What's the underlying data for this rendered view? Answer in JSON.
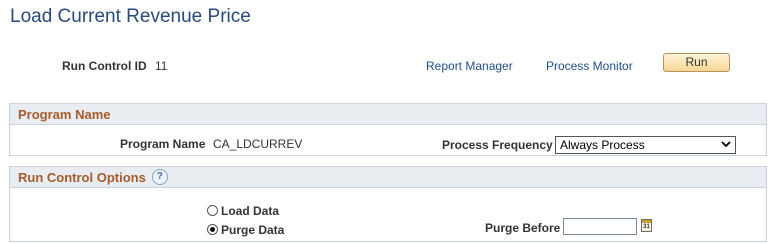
{
  "page": {
    "title": "Load Current Revenue Price"
  },
  "run_control": {
    "id_label": "Run Control ID",
    "id_value": "11",
    "report_manager_link": "Report Manager",
    "process_monitor_link": "Process Monitor",
    "run_button": "Run"
  },
  "program_section": {
    "title": "Program Name",
    "program_name_label": "Program Name",
    "program_name_value": "CA_LDCURREV",
    "frequency_label": "Process Frequency",
    "frequency_value": "Always Process"
  },
  "options_section": {
    "title": "Run Control Options",
    "help_icon": "help-icon",
    "radio_load_label": "Load Data",
    "radio_load_checked": false,
    "radio_purge_label": "Purge Data",
    "radio_purge_checked": true,
    "purge_before_label": "Purge Before",
    "purge_before_value": "",
    "calendar_icon": "calendar-icon",
    "calendar_icon_text": "31"
  }
}
